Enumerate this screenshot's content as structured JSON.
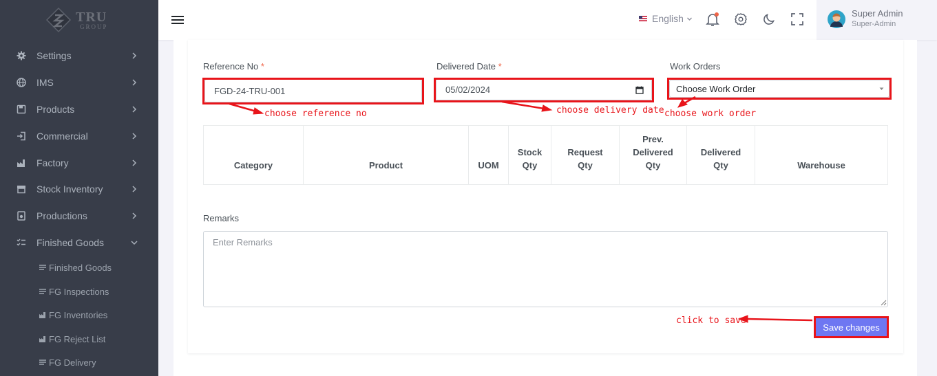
{
  "brand": {
    "name": "TRU",
    "sub": "GROUP"
  },
  "sidebar": {
    "items": [
      {
        "label": "Settings",
        "icon": "gear-icon"
      },
      {
        "label": "IMS",
        "icon": "globe-icon"
      },
      {
        "label": "Products",
        "icon": "save-icon"
      },
      {
        "label": "Commercial",
        "icon": "login-icon"
      },
      {
        "label": "Factory",
        "icon": "factory-icon"
      },
      {
        "label": "Stock Inventory",
        "icon": "store-icon"
      },
      {
        "label": "Productions",
        "icon": "production-icon"
      },
      {
        "label": "Finished Goods",
        "icon": "checklist-icon"
      }
    ],
    "subitems": [
      {
        "label": "Finished Goods",
        "icon": "list-icon"
      },
      {
        "label": "FG Inspections",
        "icon": "list-icon"
      },
      {
        "label": "FG Inventories",
        "icon": "factory-icon"
      },
      {
        "label": "FG Reject List",
        "icon": "factory-icon"
      },
      {
        "label": "FG Delivery",
        "icon": "list-icon"
      }
    ]
  },
  "topbar": {
    "language": "English",
    "user_name": "Super Admin",
    "user_role": "Super-Admin"
  },
  "form": {
    "reference_label": "Reference No",
    "reference_value": "FGD-24-TRU-001",
    "delivered_date_label": "Delivered Date",
    "delivered_date_value": "05/02/2024",
    "required_mark": "*",
    "work_orders_label": "Work Orders",
    "work_orders_value": "Choose Work Order",
    "table_headers": [
      "Category",
      "Product",
      "UOM",
      "Stock\nQty",
      "Request\nQty",
      "Prev.\nDelivered\nQty",
      "Delivered\nQty",
      "Warehouse"
    ],
    "remarks_label": "Remarks",
    "remarks_placeholder": "Enter Remarks",
    "save_label": "Save changes"
  },
  "annotations": {
    "reference": "choose reference no",
    "date": "choose delivery date",
    "work_order": "choose work order",
    "save": "click to save"
  },
  "colors": {
    "sidebar_bg": "#383d49",
    "accent": "#6e77f2",
    "annotation_red": "#e8141a",
    "required": "#f06548"
  }
}
